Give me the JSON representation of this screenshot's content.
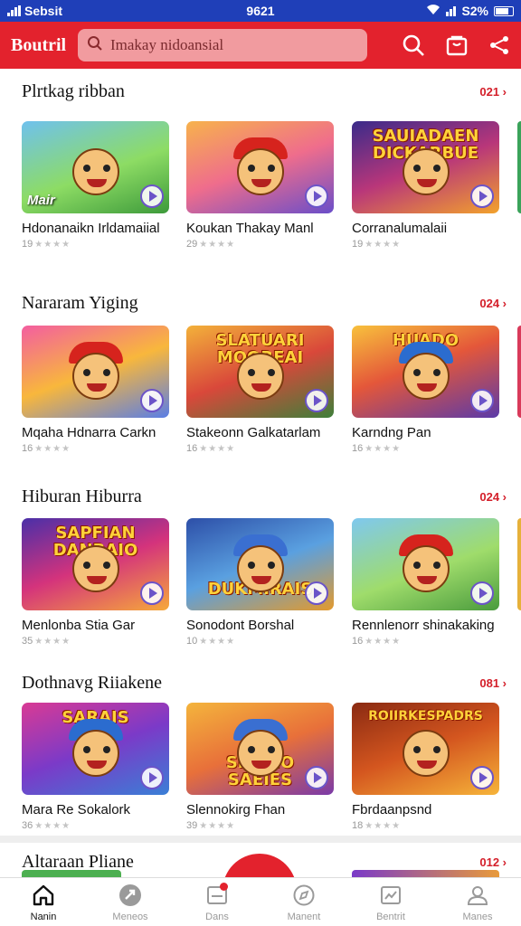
{
  "status_bar": {
    "carrier": "Sebsit",
    "time": "9621",
    "battery": "S2%"
  },
  "app_bar": {
    "brand": "Boutril",
    "search_placeholder": "Imakay nidoansial"
  },
  "sections": [
    {
      "title": "Plrtkag ribban",
      "more": "021 ›",
      "cards": [
        {
          "title": "Hdonanaikn Irldamaiial",
          "rating": "19",
          "tag": "Mair",
          "banner": "",
          "bg": "linear-gradient(160deg,#6fc1ee 0%,#8ddc64 55%,#3d9a3b 100%)",
          "cap": ""
        },
        {
          "title": "Koukan Thakay Manl",
          "rating": "29",
          "tag": "",
          "banner": "",
          "bg": "linear-gradient(160deg,#f7b24c 0%,#ef6d8c 50%,#6a4ec9 100%)",
          "cap": "#d6231d"
        },
        {
          "title": "Corranalumalaii",
          "rating": "19",
          "tag": "",
          "banner": "SAUIADAEN DICKARBUE",
          "bg": "linear-gradient(160deg,#3a2b8a 0%,#b8367a 50%,#f2a22c 100%)",
          "cap": ""
        }
      ]
    },
    {
      "title": "Nararam Yiging",
      "more": "024 ›",
      "cards": [
        {
          "title": "Mqaha Hdnarra Carkn",
          "rating": "16",
          "tag": "",
          "banner": "",
          "bg": "linear-gradient(160deg,#f35ea0 0%,#f8b73c 50%,#5a7ee6 100%)",
          "cap": "#d6231d"
        },
        {
          "title": "Stakeonn Galkatarlam",
          "rating": "16",
          "tag": "",
          "banner": "SLATUARI MOOREAI",
          "bg": "linear-gradient(160deg,#f3b13a 0%,#d9483a 50%,#3e7f3a 100%)",
          "cap": ""
        },
        {
          "title": "Karndng Pan",
          "rating": "16",
          "tag": "",
          "banner": "HUADO",
          "bg": "linear-gradient(160deg,#f8c13c 0%,#e4573a 45%,#5b3aa8 100%)",
          "cap": "#2b6ccf"
        }
      ]
    },
    {
      "title": "Hiburan Hiburra",
      "more": "024 ›",
      "cards": [
        {
          "title": "Menlonba Stia Gar",
          "rating": "35",
          "tag": "",
          "banner": "SAPFIAN DANBAIO",
          "bg": "linear-gradient(160deg,#4a2fa8 0%,#d4337c 50%,#f6a93a 100%)",
          "cap": ""
        },
        {
          "title": "Sonodont Borshal",
          "rating": "10",
          "tag": "",
          "banner": "DUKMIRAIS",
          "bg": "linear-gradient(160deg,#2d4fa8 0%,#5aa0e0 50%,#e39a2d 100%)",
          "cap": "#3a6fd1"
        },
        {
          "title": "Rennlenorr shinakaking",
          "rating": "16",
          "tag": "",
          "banner": "",
          "bg": "linear-gradient(160deg,#7fc8ef 0%,#9fdc6b 55%,#4a9b3d 100%)",
          "cap": "#d6231d"
        }
      ]
    },
    {
      "title": "Dothnavg Riiakene",
      "more": "081 ›",
      "cards": [
        {
          "title": "Mara Re Sokalork",
          "rating": "36",
          "tag": "",
          "banner": "SARAIS",
          "bg": "linear-gradient(160deg,#d93a94 0%,#7b3ac8 50%,#3a7fd6 100%)",
          "cap": "#2b6ccf"
        },
        {
          "title": "Slennokirg Fhan",
          "rating": "39",
          "tag": "",
          "banner": "SROMO SAEIES",
          "bg": "linear-gradient(160deg,#f4b43c 0%,#e8703a 50%,#7a3aa8 100%)",
          "cap": "#3a6fd1"
        },
        {
          "title": "Fbrdaanpsnd",
          "rating": "18",
          "tag": "",
          "banner": "ROIIRKESPADRS",
          "bg": "linear-gradient(160deg,#8a2a12 0%,#d4561f 50%,#f6b43a 100%)",
          "cap": ""
        }
      ]
    },
    {
      "title": "Altaraan Pliane",
      "more": "012 ›",
      "cards": []
    }
  ],
  "bottom_nav": [
    {
      "label": "Nanin",
      "icon": "home-icon"
    },
    {
      "label": "Meneos",
      "icon": "games-icon"
    },
    {
      "label": "Dans",
      "icon": "inbox-icon"
    },
    {
      "label": "Manent",
      "icon": "compass-icon"
    },
    {
      "label": "Bentrit",
      "icon": "chart-icon"
    },
    {
      "label": "Manes",
      "icon": "profile-icon"
    }
  ]
}
